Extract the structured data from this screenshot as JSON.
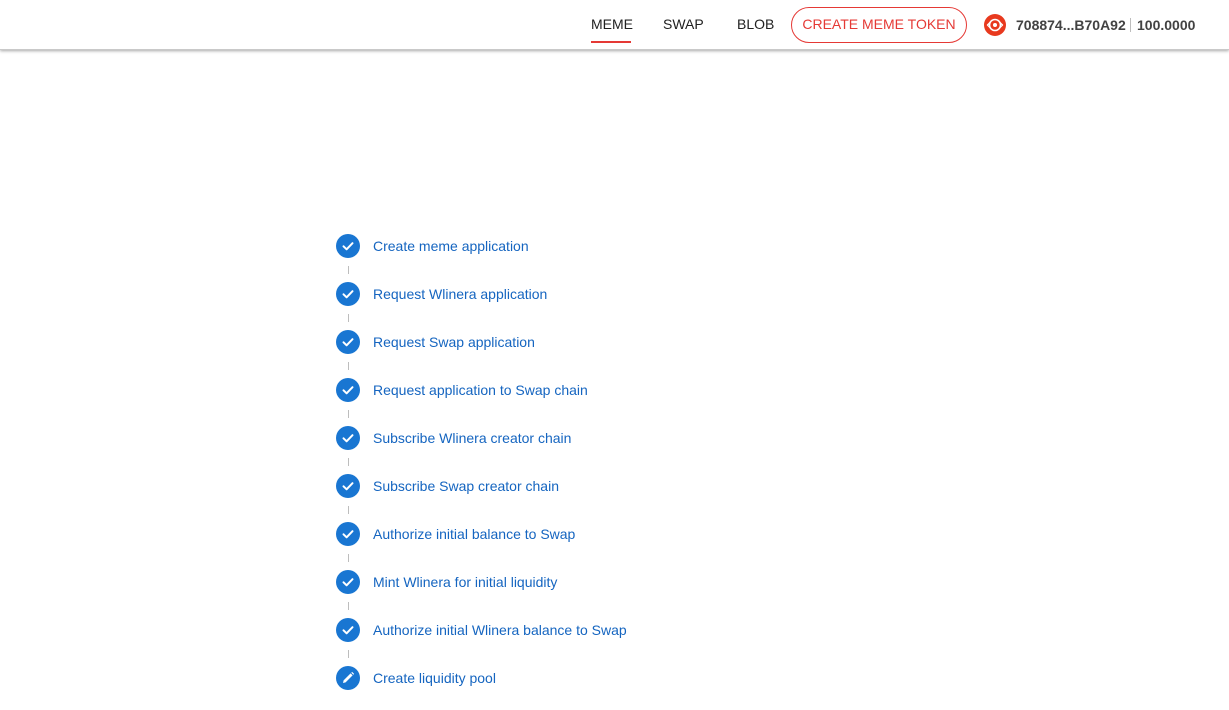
{
  "nav": {
    "tabs": [
      {
        "label": "MEME",
        "active": true
      },
      {
        "label": "SWAP",
        "active": false
      },
      {
        "label": "BLOB",
        "active": false
      }
    ],
    "create_button": "CREATE MEME TOKEN"
  },
  "wallet": {
    "icon": "linera-logo-icon",
    "address": "708874...B70A92",
    "balance": "100.0000"
  },
  "steps": [
    {
      "label": "Create meme application",
      "status": "done",
      "icon": "check-icon"
    },
    {
      "label": "Request Wlinera application",
      "status": "done",
      "icon": "check-icon"
    },
    {
      "label": "Request Swap application",
      "status": "done",
      "icon": "check-icon"
    },
    {
      "label": "Request application to Swap chain",
      "status": "done",
      "icon": "check-icon"
    },
    {
      "label": "Subscribe Wlinera creator chain",
      "status": "done",
      "icon": "check-icon"
    },
    {
      "label": "Subscribe Swap creator chain",
      "status": "done",
      "icon": "check-icon"
    },
    {
      "label": "Authorize initial balance to Swap",
      "status": "done",
      "icon": "check-icon"
    },
    {
      "label": "Mint Wlinera for initial liquidity",
      "status": "done",
      "icon": "check-icon"
    },
    {
      "label": "Authorize initial Wlinera balance to Swap",
      "status": "done",
      "icon": "check-icon"
    },
    {
      "label": "Create liquidity pool",
      "status": "active",
      "icon": "pencil-icon"
    }
  ],
  "colors": {
    "accent": "#e53935",
    "step": "#1976d2",
    "step_label": "#1565c0"
  }
}
